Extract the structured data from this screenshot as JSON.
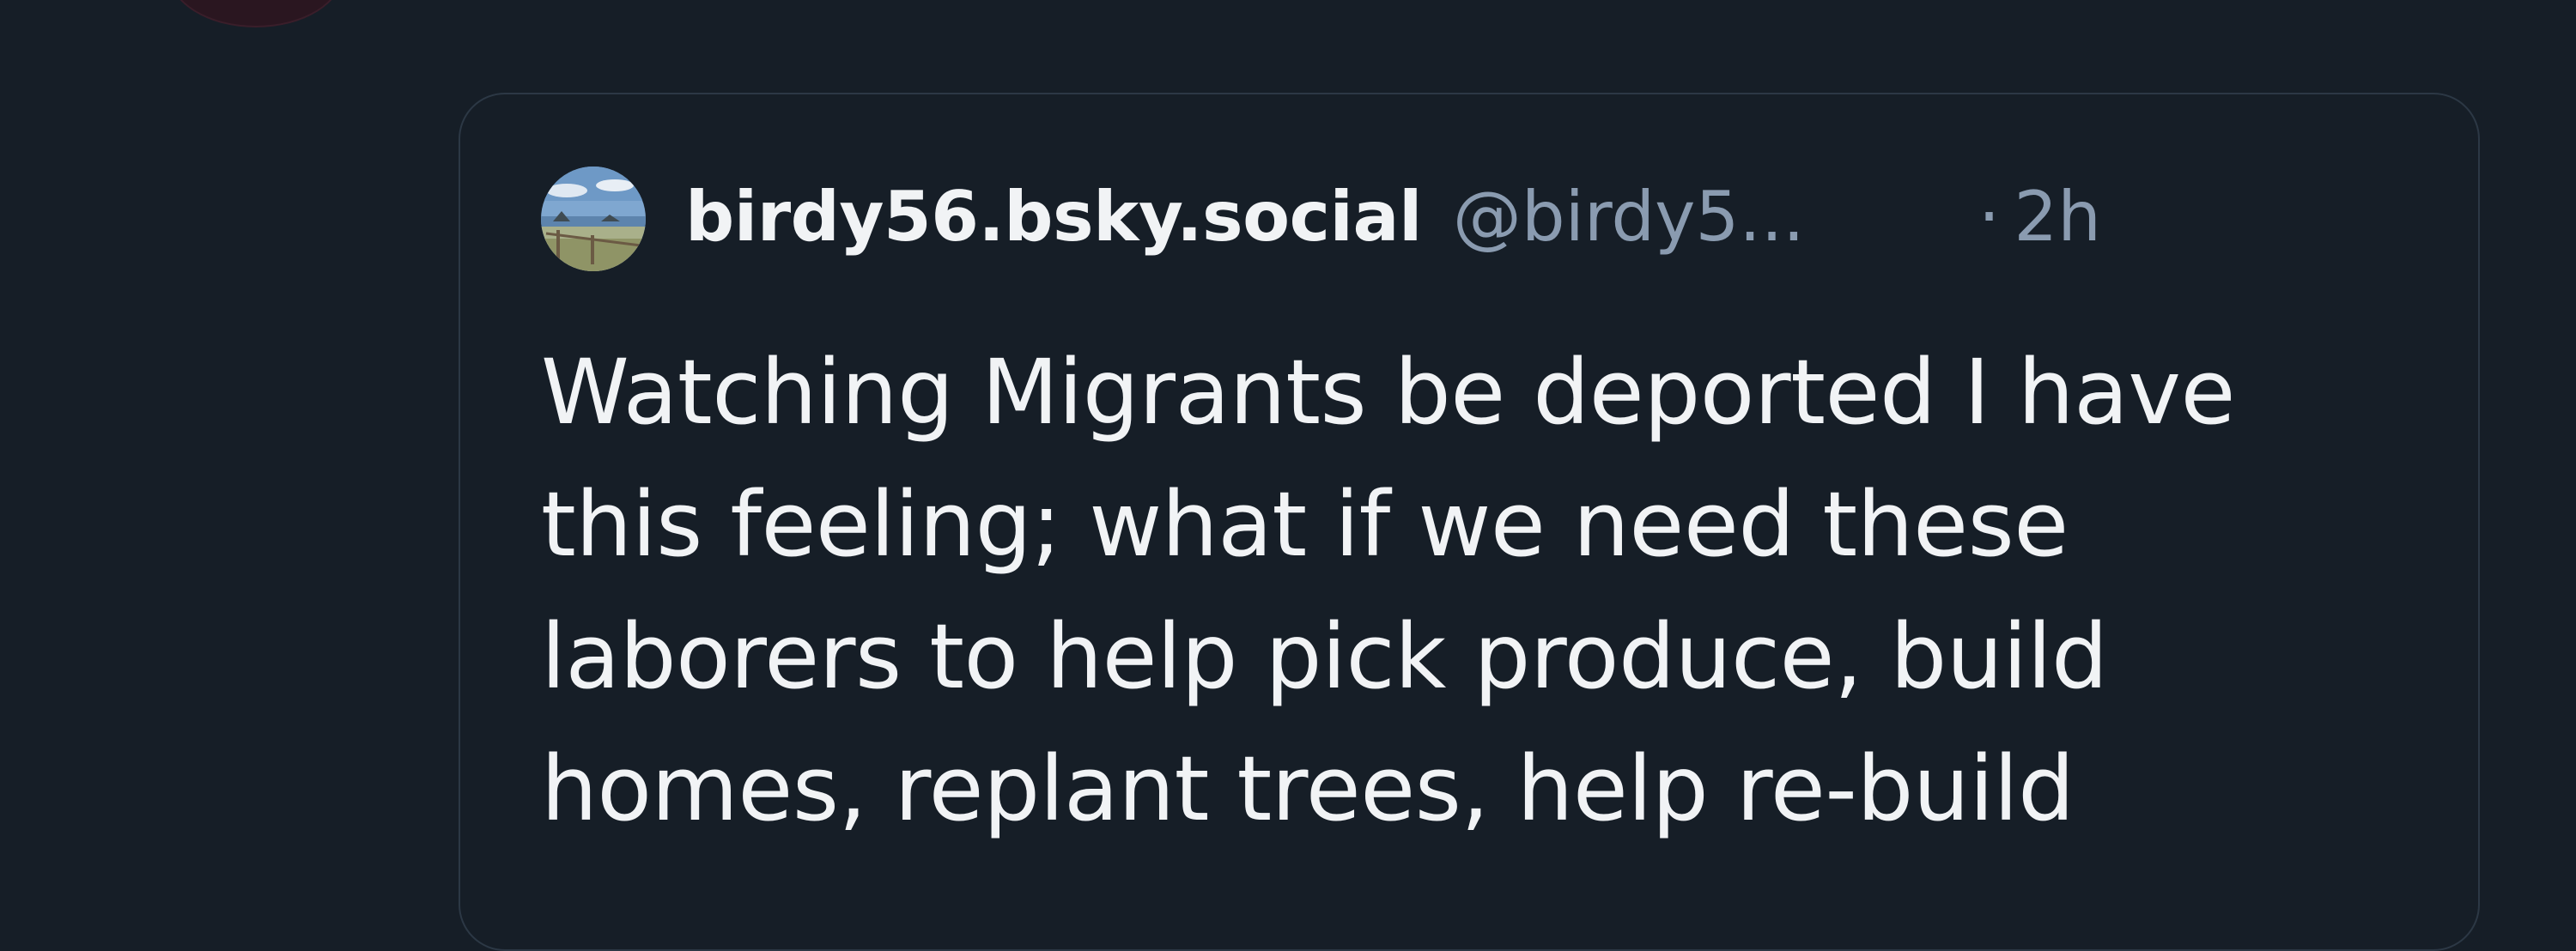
{
  "quote": {
    "author": {
      "display_name": "birdy56.bsky.social",
      "handle": "@birdy5...",
      "separator": "·",
      "time": "2h"
    },
    "text_lines": [
      "Watching Migrants be deported I have",
      "this feeling; what if we need these",
      "laborers to help pick produce, build",
      "homes, replant trees, help re-build"
    ]
  }
}
